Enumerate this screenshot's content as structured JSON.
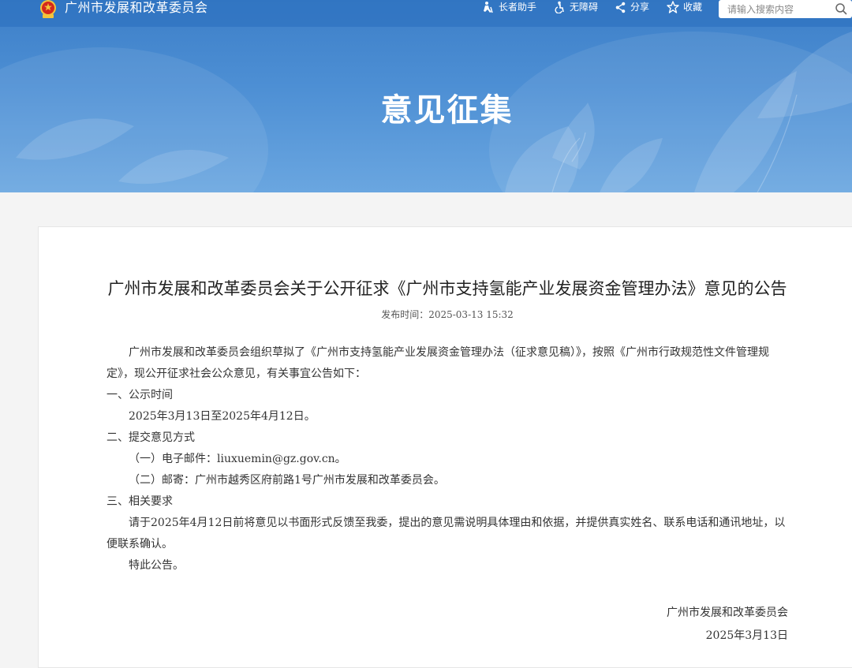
{
  "header": {
    "site_name": "广州市发展和改革委员会",
    "tools": [
      {
        "label": "长者助手",
        "icon": "elder-assistant-icon"
      },
      {
        "label": "无障碍",
        "icon": "accessibility-icon"
      },
      {
        "label": "分享",
        "icon": "share-icon"
      },
      {
        "label": "收藏",
        "icon": "star-icon"
      }
    ],
    "search": {
      "placeholder": "请输入搜索内容",
      "icon": "search-icon"
    }
  },
  "banner": {
    "title": "意见征集"
  },
  "article": {
    "title": "广州市发展和改革委员会关于公开征求《广州市支持氢能产业发展资金管理办法》意见的公告",
    "publish_label": "发布时间：",
    "publish_time": "2025-03-13 15:32",
    "paragraphs": [
      "广州市发展和改革委员会组织草拟了《广州市支持氢能产业发展资金管理办法（征求意见稿）》，按照《广州市行政规范性文件管理规定》，现公开征求社会公众意见，有关事宜公告如下：",
      "一、公示时间",
      "2025年3月13日至2025年4月12日。",
      "二、提交意见方式",
      "（一）电子邮件：liuxuemin@gz.gov.cn。",
      "（二）邮寄：广州市越秀区府前路1号广州市发展和改革委员会。",
      "三、相关要求",
      "请于2025年4月12日前将意见以书面形式反馈至我委，提出的意见需说明具体理由和依据，并提供真实姓名、联系电话和通讯地址，以便联系确认。",
      "特此公告。"
    ],
    "signature": "广州市发展和改革委员会",
    "date": "2025年3月13日"
  },
  "colors": {
    "banner": "#4d8fd4",
    "topbar": "#2f73bf",
    "emblem_red": "#d4281c",
    "emblem_gold": "#f3c43c"
  }
}
